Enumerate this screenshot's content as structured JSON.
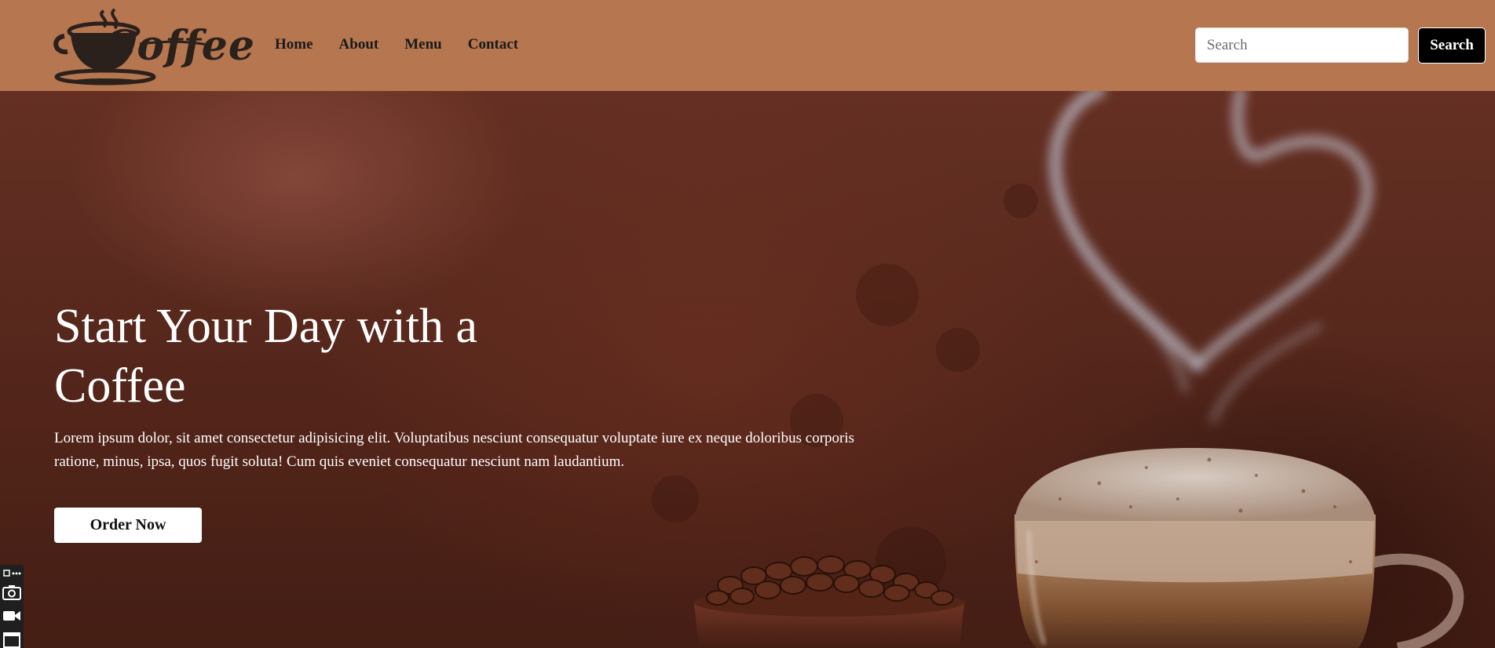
{
  "header": {
    "logo_text": "Coffee",
    "nav": [
      {
        "label": "Home"
      },
      {
        "label": "About"
      },
      {
        "label": "Menu"
      },
      {
        "label": "Contact"
      }
    ],
    "search": {
      "placeholder": "Search",
      "value": "",
      "button_label": "Search"
    }
  },
  "hero": {
    "title": "Start Your Day with a Coffee",
    "text": "Lorem ipsum dolor, sit amet consectetur adipisicing elit. Voluptatibus nesciunt consequatur voluptate iure ex neque doloribus corporis ratione, minus, ipsa, quos fugit soluta! Cum quis eveniet consequatur nesciunt nam laudantium.",
    "order_button": "Order Now"
  },
  "colors": {
    "header_bg": "#b57650",
    "hero_bg": "#5e2b1f",
    "search_button_bg": "#000000",
    "text_light": "#ffffff"
  },
  "side_tools": {
    "icons": [
      "extension-menu-icon",
      "camera-icon",
      "video-camera-icon",
      "window-icon"
    ]
  }
}
